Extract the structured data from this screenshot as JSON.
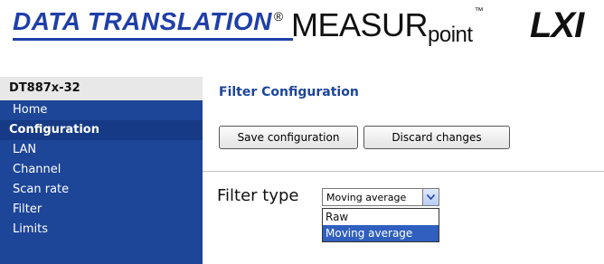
{
  "header": {
    "brand": "DATA TRANSLATION",
    "brand_reg": "®",
    "product_main": "MEASUR",
    "product_sub": "point",
    "product_tm": "™",
    "lxi_logo": "LXI"
  },
  "sidebar": {
    "device": "DT887x-32",
    "items": [
      {
        "label": "Home",
        "type": "link"
      },
      {
        "label": "Configuration",
        "type": "section"
      },
      {
        "label": "LAN",
        "type": "link"
      },
      {
        "label": "Channel",
        "type": "link"
      },
      {
        "label": "Scan rate",
        "type": "link"
      },
      {
        "label": "Filter",
        "type": "link"
      },
      {
        "label": "Limits",
        "type": "link"
      }
    ]
  },
  "main": {
    "title": "Filter Configuration",
    "save_label": "Save configuration",
    "discard_label": "Discard changes",
    "filter_type_label": "Filter type",
    "filter_selected": "Moving average",
    "filter_options": [
      "Raw",
      "Moving average"
    ]
  },
  "colors": {
    "brand_blue": "#1f3fa8",
    "sidebar_blue": "#1d4598",
    "selected_blue": "#2f5fbf",
    "lxi_red": "#c00000"
  }
}
